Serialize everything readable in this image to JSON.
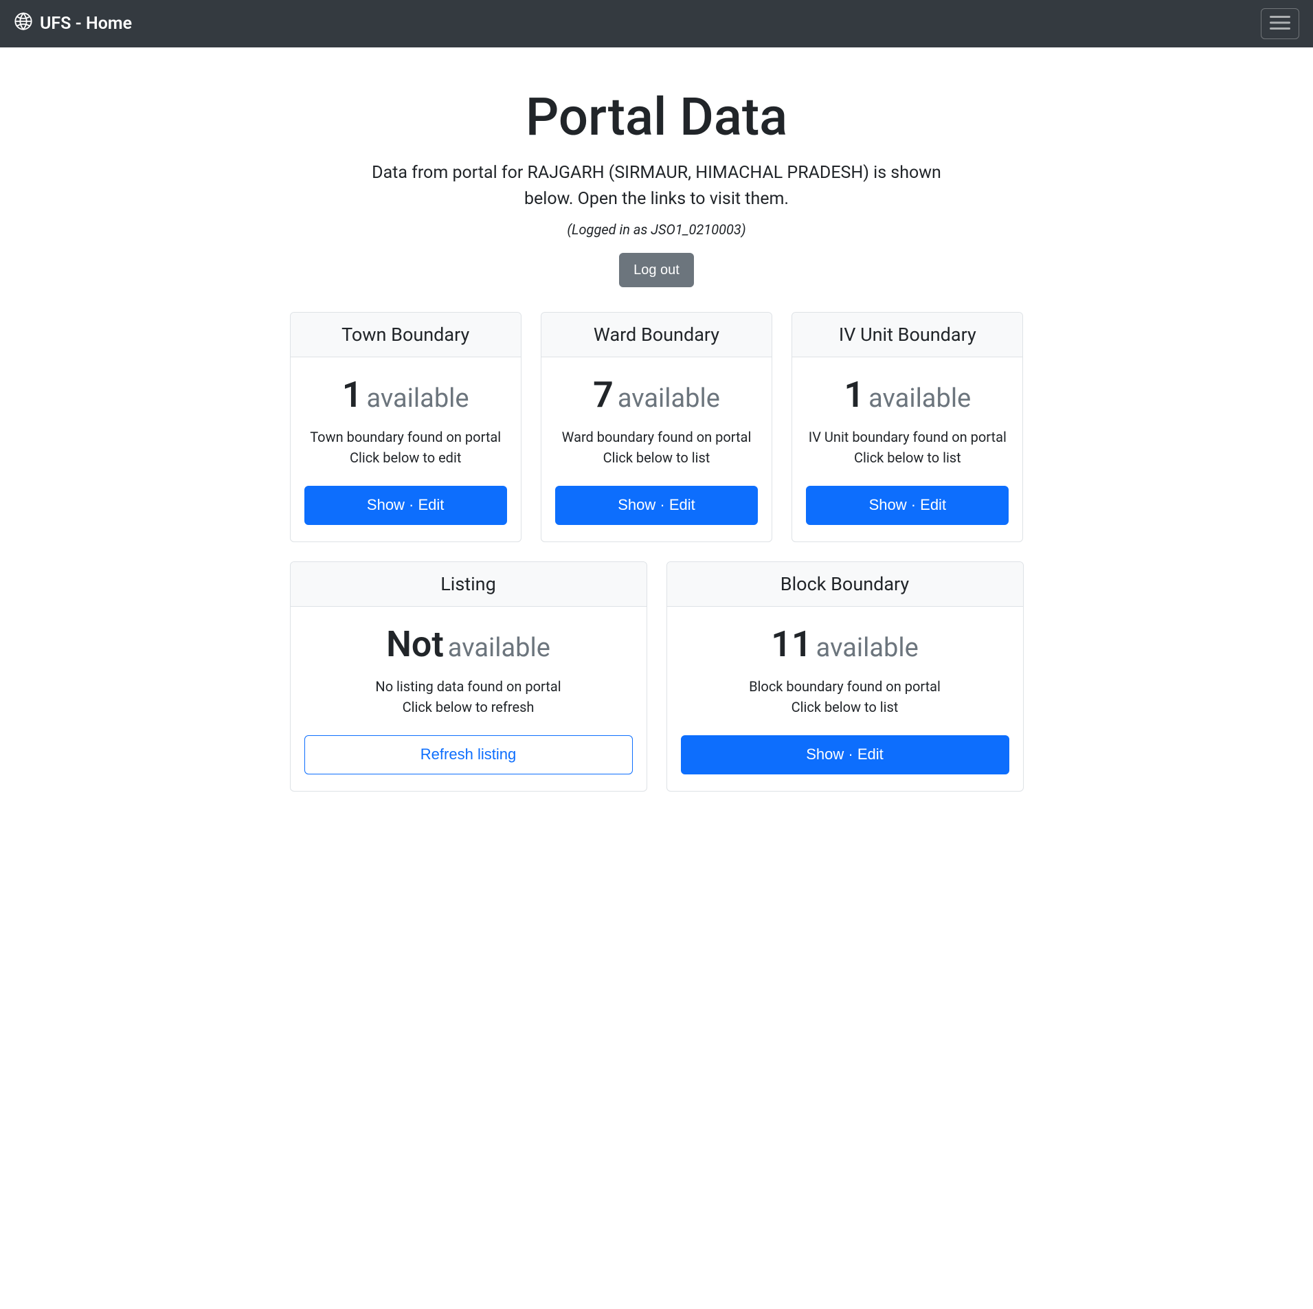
{
  "navbar": {
    "brand": "UFS - Home"
  },
  "hero": {
    "title": "Portal Data",
    "lead": "Data from portal for RAJGARH (SIRMAUR, HIMACHAL PRADESH) is shown below. Open the links to visit them.",
    "logged_in": "(Logged in as JSO1_0210003)",
    "logout_label": "Log out"
  },
  "cards": {
    "town": {
      "header": "Town Boundary",
      "count": "1",
      "suffix": "available",
      "desc1": "Town boundary found on portal",
      "desc2": "Click below to edit",
      "button": "Show · Edit"
    },
    "ward": {
      "header": "Ward Boundary",
      "count": "7",
      "suffix": "available",
      "desc1": "Ward boundary found on portal",
      "desc2": "Click below to list",
      "button": "Show · Edit"
    },
    "iv": {
      "header": "IV Unit Boundary",
      "count": "1",
      "suffix": "available",
      "desc1": "IV Unit boundary found on portal",
      "desc2": "Click below to list",
      "button": "Show · Edit"
    },
    "listing": {
      "header": "Listing",
      "count": "Not",
      "suffix": "available",
      "desc1": "No listing data found on portal",
      "desc2": "Click below to refresh",
      "button": "Refresh listing"
    },
    "block": {
      "header": "Block Boundary",
      "count": "11",
      "suffix": "available",
      "desc1": "Block boundary found on portal",
      "desc2": "Click below to list",
      "button": "Show · Edit"
    }
  }
}
